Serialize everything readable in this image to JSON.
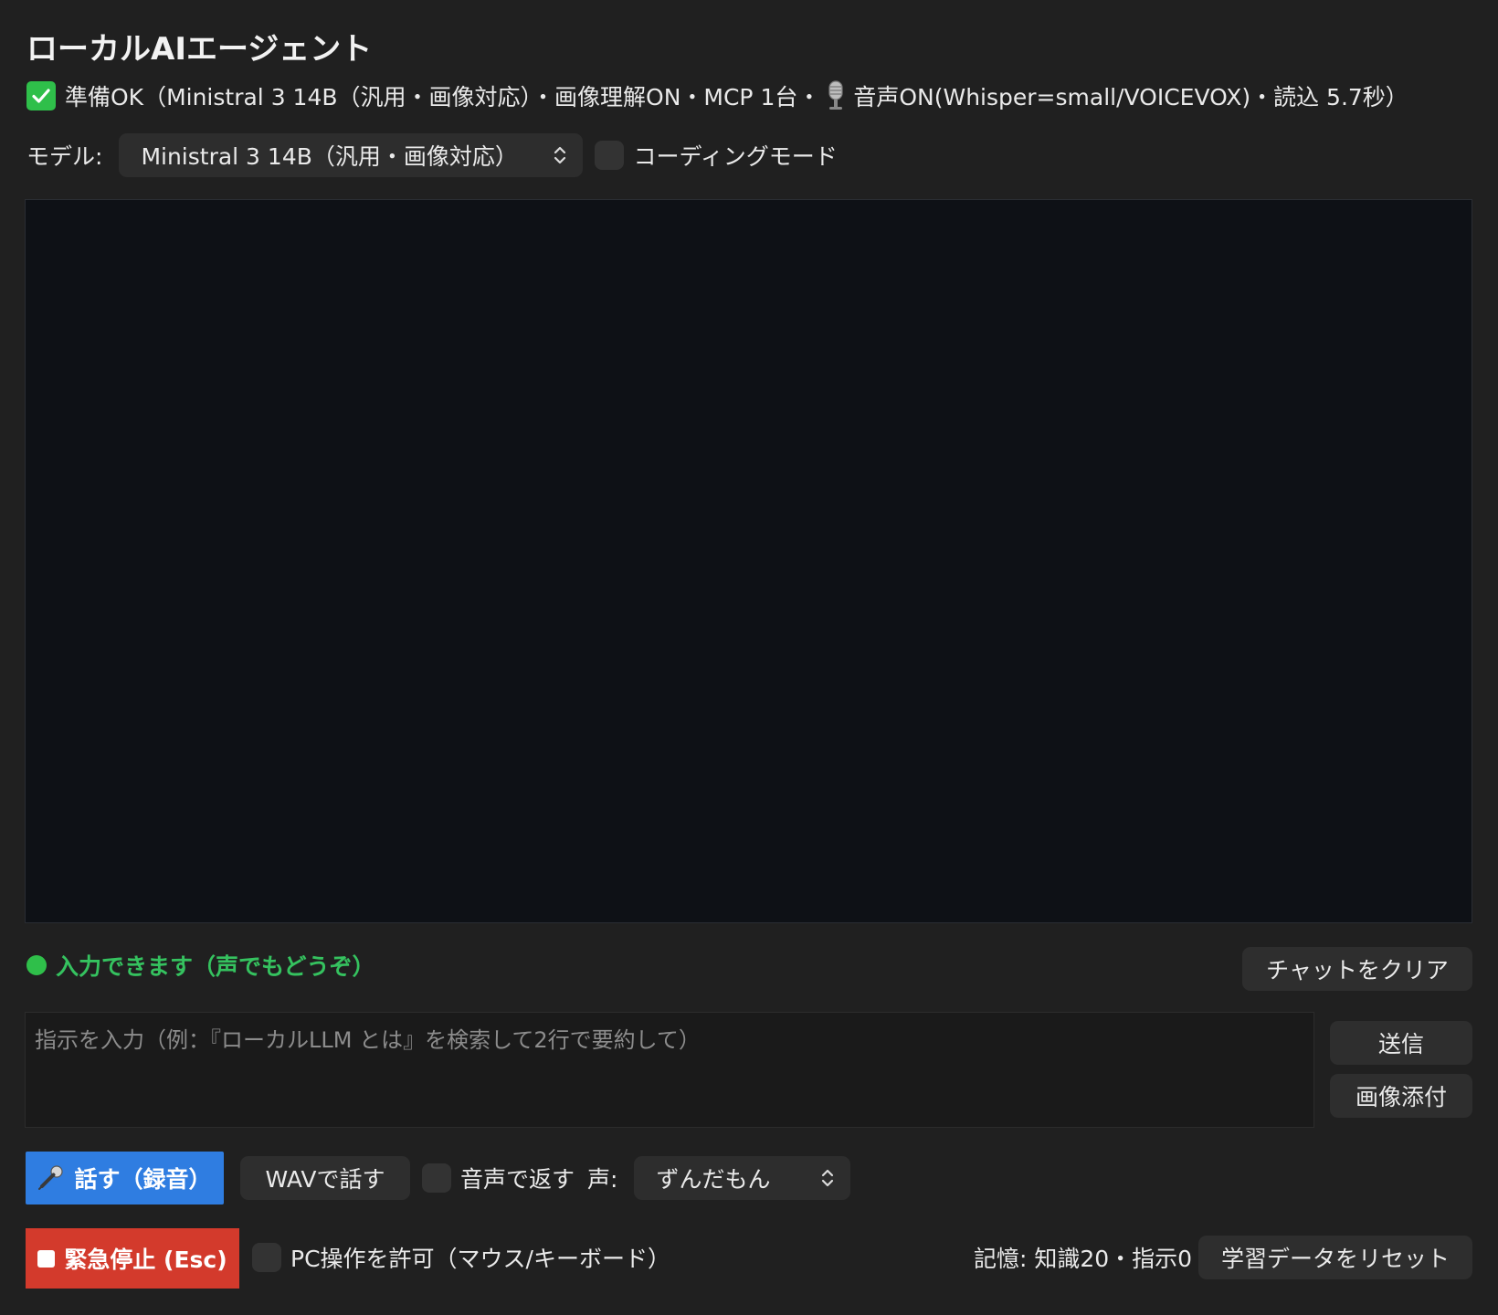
{
  "app": {
    "title": "ローカルAIエージェント"
  },
  "status": {
    "icon": "check-mark-icon",
    "prefix": "準備OK（Ministral 3 14B（汎用・画像対応）・画像理解ON・MCP 1台・",
    "mic_icon": "studio-microphone-icon",
    "suffix": "音声ON(Whisper=small/VOICEVOX)・読込 5.7秒）"
  },
  "model": {
    "label": "モデル:",
    "selected": "Ministral 3 14B（汎用・画像対応）",
    "coding_mode_label": "コーディングモード",
    "coding_mode_checked": false
  },
  "chat": {
    "messages": []
  },
  "ready": {
    "text": "入力できます（声でもどうぞ）",
    "color": "#2fbf4a"
  },
  "actions": {
    "clear_chat": "チャットをクリア",
    "send": "送信",
    "attach_image": "画像添付"
  },
  "input": {
    "value": "",
    "placeholder": "指示を入力（例：『ローカルLLM とは』を検索して2行で要約して）"
  },
  "voice": {
    "talk_button": "話す（録音）",
    "wav_button": "WAVで話す",
    "reply_voice_label": "音声で返す",
    "reply_voice_checked": false,
    "voice_label": "声:",
    "voice_selected": "ずんだもん"
  },
  "controls": {
    "emergency_stop": "緊急停止 (Esc)",
    "allow_pc_label": "PC操作を許可（マウス/キーボード）",
    "allow_pc_checked": false,
    "memory_text": "記憶: 知識20・指示0",
    "reset_learning": "学習データをリセット"
  },
  "colors": {
    "accent_blue": "#2f7de1",
    "danger_red": "#d33a2c",
    "ok_green": "#2fbf4a"
  }
}
